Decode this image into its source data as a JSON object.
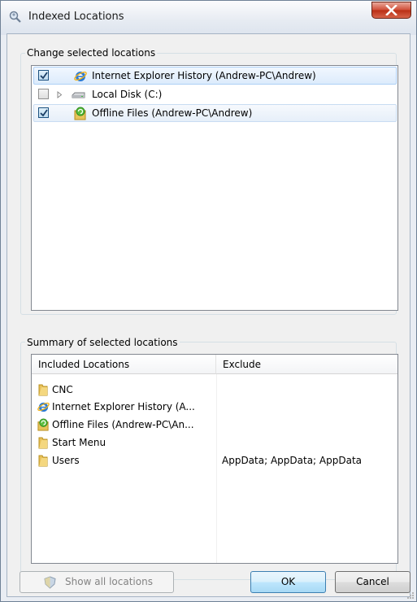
{
  "window": {
    "title": "Indexed Locations"
  },
  "change_section": {
    "label": "Change selected locations",
    "items": [
      {
        "label": "Internet Explorer History (Andrew-PC\\Andrew)",
        "checked": true,
        "icon": "ie-icon"
      },
      {
        "label": "Local Disk (C:)",
        "checked": false,
        "icon": "drive-icon"
      },
      {
        "label": "Offline Files (Andrew-PC\\Andrew)",
        "checked": true,
        "icon": "offline-files-icon"
      }
    ]
  },
  "summary_section": {
    "label": "Summary of selected locations",
    "columns": [
      "Included Locations",
      "Exclude"
    ],
    "rows": [
      {
        "location": "CNC",
        "exclude": "",
        "icon": "folder-icon"
      },
      {
        "location": "Internet Explorer History (A...",
        "exclude": "",
        "icon": "ie-icon"
      },
      {
        "location": "Offline Files (Andrew-PC\\An...",
        "exclude": "",
        "icon": "offline-files-icon"
      },
      {
        "location": "Start Menu",
        "exclude": "",
        "icon": "folder-icon"
      },
      {
        "location": "Users",
        "exclude": "AppData; AppData; AppData",
        "icon": "folder-icon"
      }
    ]
  },
  "buttons": {
    "show_all": "Show all locations",
    "ok": "OK",
    "cancel": "Cancel"
  },
  "colors": {
    "selection_fill": "#dcebfc",
    "selection_border": "#aed0f6",
    "default_button": "#bee6fd",
    "close_button": "#cf4b34"
  }
}
